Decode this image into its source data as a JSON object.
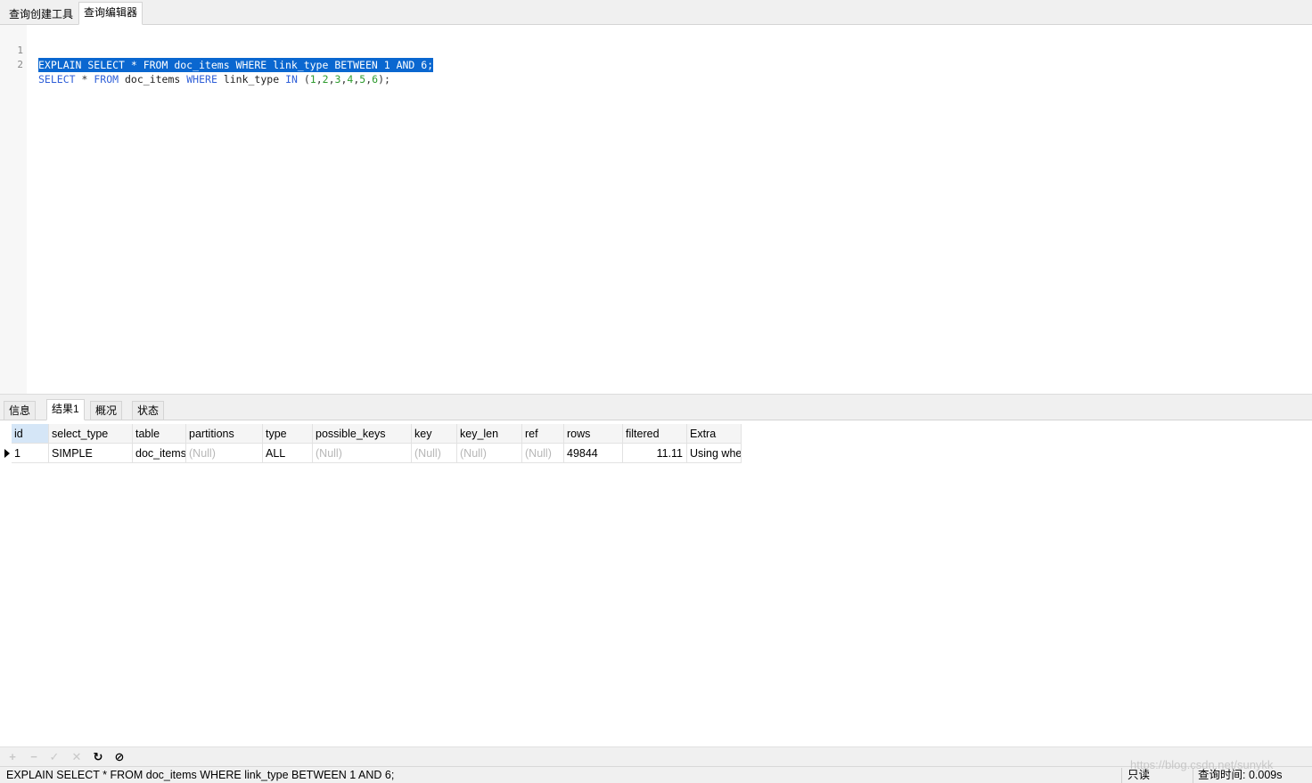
{
  "top_tabs": [
    {
      "label": "查询创建工具",
      "active": false
    },
    {
      "label": "查询编辑器",
      "active": true
    }
  ],
  "editor": {
    "lines": [
      {
        "number": "1",
        "text": "EXPLAIN SELECT * FROM doc_items WHERE link_type BETWEEN 1 AND 6;"
      },
      {
        "number": "2",
        "text": "SELECT * FROM doc_items WHERE link_type IN (1,2,3,4,5,6);"
      }
    ]
  },
  "result_tabs": [
    {
      "label": "信息",
      "active": false
    },
    {
      "label": "结果1",
      "active": true
    },
    {
      "label": "概况",
      "active": false
    },
    {
      "label": "状态",
      "active": false
    }
  ],
  "grid": {
    "columns": [
      "id",
      "select_type",
      "table",
      "partitions",
      "type",
      "possible_keys",
      "key",
      "key_len",
      "ref",
      "rows",
      "filtered",
      "Extra"
    ],
    "rows": [
      [
        "1",
        "SIMPLE",
        "doc_items",
        "(Null)",
        "ALL",
        "(Null)",
        "(Null)",
        "(Null)",
        "(Null)",
        "49844",
        "11.11",
        "Using whe"
      ]
    ]
  },
  "toolbar": {
    "add": "+",
    "remove": "−",
    "apply": "✓",
    "discard": "✕",
    "refresh": "↻",
    "stop": "⊘"
  },
  "status": {
    "sql": "EXPLAIN SELECT * FROM doc_items WHERE link_type BETWEEN 1 AND 6;",
    "mode": "只读",
    "query_time": "查询时间: 0.009s"
  },
  "watermark": "https://blog.csdn.net/sunykk",
  "colors": {
    "selection": "#0a67d0",
    "keyword": "#3060d8",
    "number": "#2e9b2e"
  }
}
